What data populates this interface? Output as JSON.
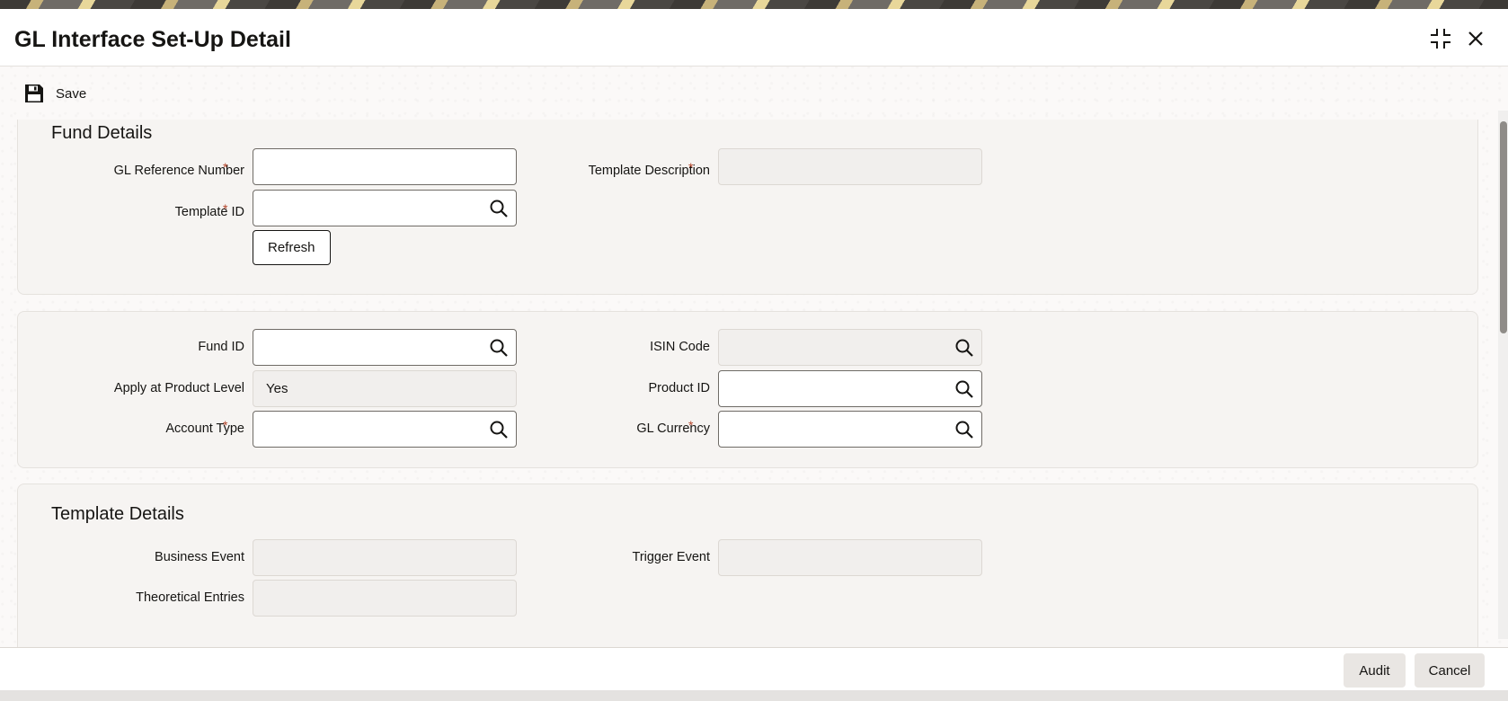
{
  "window": {
    "title": "GL Interface Set-Up Detail"
  },
  "toolbar": {
    "save_label": "Save"
  },
  "fund_details": {
    "section_title": "Fund Details",
    "gl_reference_number": {
      "label": "GL Reference Number",
      "required": "*",
      "value": ""
    },
    "template_description": {
      "label": "Template Description",
      "required": "*",
      "value": ""
    },
    "template_id": {
      "label": "Template ID",
      "required": "*",
      "value": ""
    },
    "refresh_label": "Refresh"
  },
  "fund_info": {
    "fund_id": {
      "label": "Fund ID",
      "value": ""
    },
    "isin_code": {
      "label": "ISIN Code",
      "value": ""
    },
    "apply_at_product_level": {
      "label": "Apply at Product Level",
      "value": "Yes"
    },
    "product_id": {
      "label": "Product ID",
      "value": ""
    },
    "account_type": {
      "label": "Account Type",
      "required": "*",
      "value": ""
    },
    "gl_currency": {
      "label": "GL Currency",
      "required": "*",
      "value": ""
    }
  },
  "template_details": {
    "section_title": "Template Details",
    "business_event": {
      "label": "Business Event",
      "value": ""
    },
    "trigger_event": {
      "label": "Trigger Event",
      "value": ""
    },
    "theoretical_entries": {
      "label": "Theoretical Entries",
      "value": ""
    }
  },
  "footer": {
    "audit_label": "Audit",
    "cancel_label": "Cancel"
  },
  "icons": {
    "save": "floppy-disk-icon",
    "search": "magnifier-icon",
    "maximize": "collapse-corners-icon",
    "close": "close-icon"
  }
}
